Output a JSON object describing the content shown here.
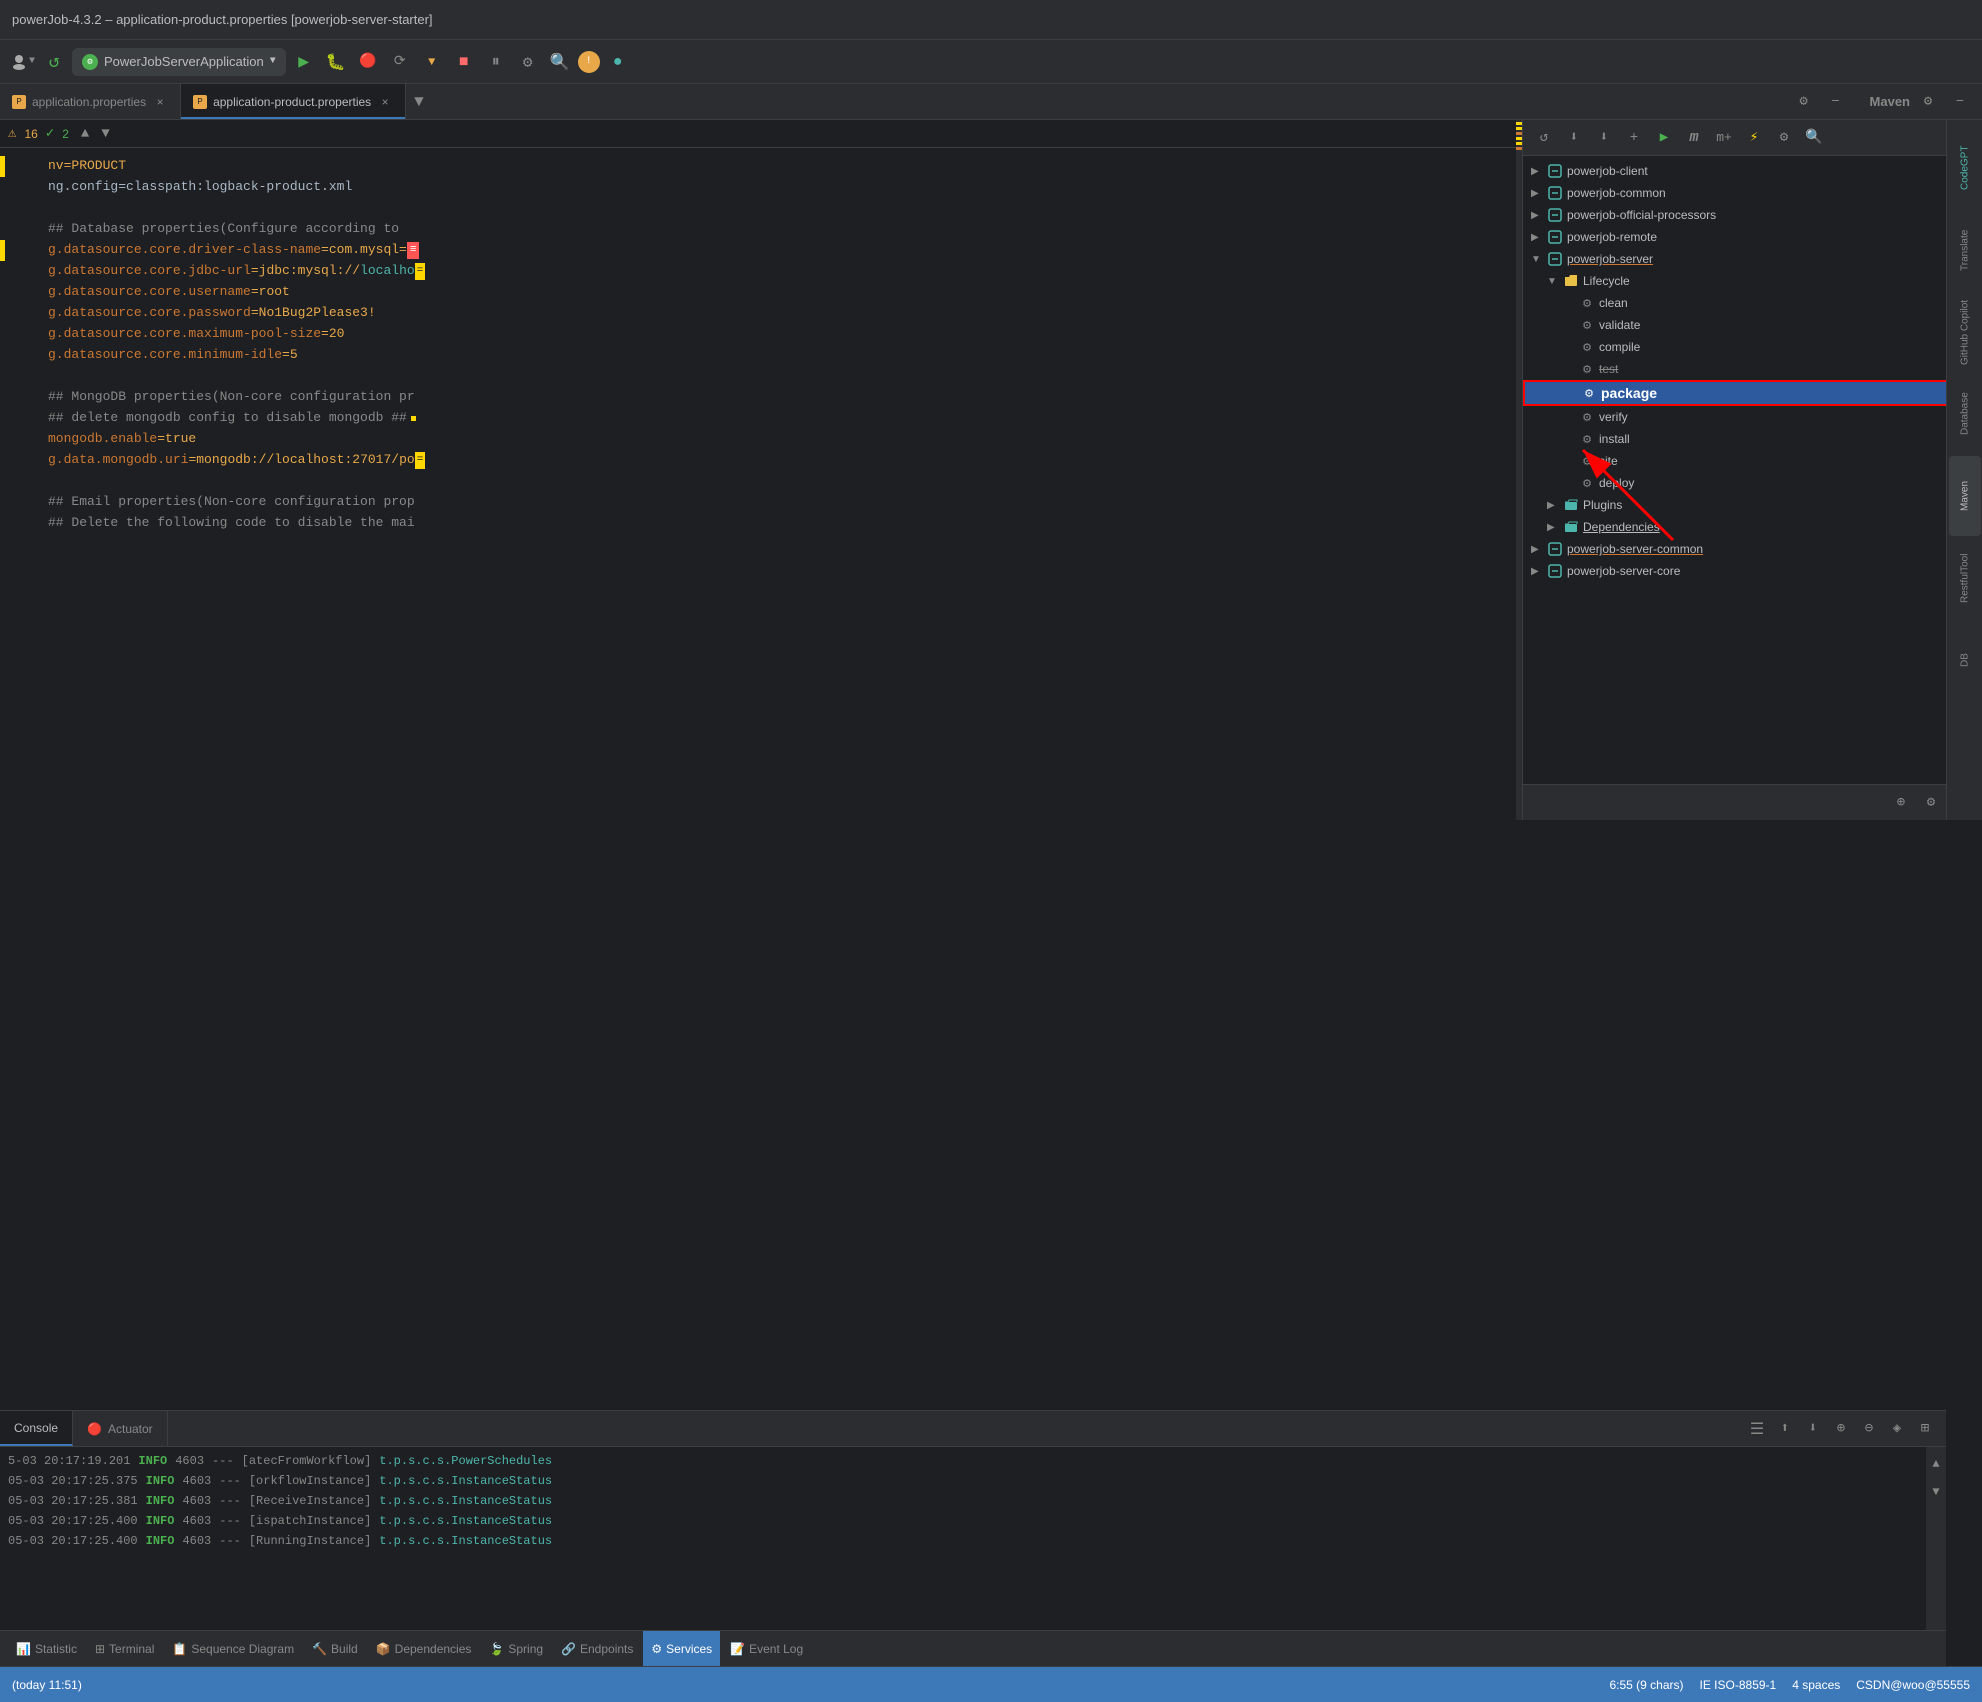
{
  "window": {
    "title": "powerJob-4.3.2 – application-product.properties [powerjob-server-starter]"
  },
  "toolbar": {
    "run_config": "PowerJobServerApplication",
    "run_label": "▶",
    "debug_label": "🐛",
    "stop_label": "■"
  },
  "tabs": {
    "items": [
      {
        "label": "application.properties",
        "active": false
      },
      {
        "label": "application-product.properties",
        "active": true
      }
    ]
  },
  "warning_bar": {
    "warning_count": "16",
    "check_count": "2"
  },
  "editor": {
    "lines": [
      {
        "num": "",
        "content_parts": [
          {
            "text": "nv=PRODUCT",
            "color": "yellow"
          }
        ]
      },
      {
        "num": "",
        "content_parts": [
          {
            "text": "ng.config=classpath:logback-product.xml",
            "color": "white"
          }
        ]
      },
      {
        "num": "",
        "content_parts": []
      },
      {
        "num": "",
        "content_parts": [
          {
            "text": "## Database properties(Configure according to",
            "color": "gray"
          }
        ]
      },
      {
        "num": "",
        "content_parts": [
          {
            "text": "g.datasource.core.driver-class-name",
            "color": "orange"
          },
          {
            "text": "=com.mysql=",
            "color": "yellow"
          }
        ]
      },
      {
        "num": "",
        "content_parts": [
          {
            "text": "g.datasource.core.jdbc-url",
            "color": "orange"
          },
          {
            "text": "=jdbc:mysql://",
            "color": "yellow"
          },
          {
            "text": "localho",
            "color": "cyan"
          }
        ]
      },
      {
        "num": "",
        "content_parts": [
          {
            "text": "g.datasource.core.username",
            "color": "orange"
          },
          {
            "text": "=root",
            "color": "yellow"
          }
        ]
      },
      {
        "num": "",
        "content_parts": [
          {
            "text": "g.datasource.core.password",
            "color": "orange"
          },
          {
            "text": "=No1Bug2Please3!",
            "color": "yellow"
          }
        ]
      },
      {
        "num": "",
        "content_parts": [
          {
            "text": "g.datasource.core.maximum-pool-size",
            "color": "orange"
          },
          {
            "text": "=20",
            "color": "yellow"
          }
        ]
      },
      {
        "num": "",
        "content_parts": [
          {
            "text": "g.datasource.core.minimum-idle",
            "color": "orange"
          },
          {
            "text": "=5",
            "color": "yellow"
          }
        ]
      },
      {
        "num": "",
        "content_parts": []
      },
      {
        "num": "",
        "content_parts": [
          {
            "text": "## MongoDB properties(Non-core configuration pr",
            "color": "gray"
          }
        ]
      },
      {
        "num": "",
        "content_parts": [
          {
            "text": "## delete mongodb config to disable mongodb ##",
            "color": "gray"
          }
        ]
      },
      {
        "num": "",
        "content_parts": [
          {
            "text": "mongodb.enable",
            "color": "orange"
          },
          {
            "text": "=true",
            "color": "yellow"
          }
        ]
      },
      {
        "num": "",
        "content_parts": [
          {
            "text": "g.data.mongodb.uri",
            "color": "orange"
          },
          {
            "text": "=mongodb://localhost:27017/po",
            "color": "yellow"
          }
        ]
      },
      {
        "num": "",
        "content_parts": []
      },
      {
        "num": "",
        "content_parts": [
          {
            "text": "## Email properties(Non-core configuration prop",
            "color": "gray"
          }
        ]
      },
      {
        "num": "",
        "content_parts": [
          {
            "text": "## Delete the following code to disable the mai",
            "color": "gray"
          }
        ]
      }
    ]
  },
  "maven": {
    "title": "Maven",
    "tree": {
      "items": [
        {
          "indent": 0,
          "label": "powerjob-client",
          "icon": "module",
          "expanded": false,
          "arrow": "▶"
        },
        {
          "indent": 0,
          "label": "powerjob-common",
          "icon": "module",
          "expanded": false,
          "arrow": "▶"
        },
        {
          "indent": 0,
          "label": "powerjob-official-processors",
          "icon": "module",
          "expanded": false,
          "arrow": "▶"
        },
        {
          "indent": 0,
          "label": "powerjob-remote",
          "icon": "module",
          "expanded": false,
          "arrow": "▶"
        },
        {
          "indent": 0,
          "label": "powerjob-server",
          "icon": "module",
          "expanded": true,
          "arrow": "▼"
        },
        {
          "indent": 1,
          "label": "Lifecycle",
          "icon": "folder",
          "expanded": true,
          "arrow": "▼"
        },
        {
          "indent": 2,
          "label": "clean",
          "icon": "gear",
          "arrow": ""
        },
        {
          "indent": 2,
          "label": "validate",
          "icon": "gear",
          "arrow": ""
        },
        {
          "indent": 2,
          "label": "compile",
          "icon": "gear",
          "arrow": ""
        },
        {
          "indent": 2,
          "label": "test",
          "icon": "gear",
          "arrow": ""
        },
        {
          "indent": 2,
          "label": "package",
          "icon": "gear",
          "arrow": "",
          "selected": true
        },
        {
          "indent": 2,
          "label": "verify",
          "icon": "gear",
          "arrow": ""
        },
        {
          "indent": 2,
          "label": "install",
          "icon": "gear",
          "arrow": ""
        },
        {
          "indent": 2,
          "label": "site",
          "icon": "gear",
          "arrow": ""
        },
        {
          "indent": 2,
          "label": "deploy",
          "icon": "gear",
          "arrow": ""
        },
        {
          "indent": 1,
          "label": "Plugins",
          "icon": "folder",
          "expanded": false,
          "arrow": "▶"
        },
        {
          "indent": 1,
          "label": "Dependencies",
          "icon": "folder",
          "expanded": false,
          "arrow": "▶"
        },
        {
          "indent": 0,
          "label": "powerjob-server-common",
          "icon": "module",
          "expanded": false,
          "arrow": "▶"
        },
        {
          "indent": 0,
          "label": "powerjob-server-core",
          "icon": "module",
          "expanded": false,
          "arrow": "▶"
        }
      ]
    }
  },
  "bottom_panel": {
    "tabs": [
      {
        "label": "Console",
        "active": true,
        "icon": ""
      },
      {
        "label": "Actuator",
        "active": false,
        "icon": "🔴"
      }
    ],
    "log_lines": [
      {
        "timestamp": "5-03 20:17:19.201",
        "level": "INFO",
        "pid": "4603",
        "sep": "---",
        "thread": "[atecFromWorkflow]",
        "class": "t.p.s.c.s.PowerSchedules"
      },
      {
        "timestamp": "05-03 20:17:25.375",
        "level": "INFO",
        "pid": "4603",
        "sep": "---",
        "thread": "[orkflowInstance]",
        "class": "t.p.s.c.s.InstanceStatus"
      },
      {
        "timestamp": "05-03 20:17:25.381",
        "level": "INFO",
        "pid": "4603",
        "sep": "---",
        "thread": "[ReceiveInstance]",
        "class": "t.p.s.c.s.InstanceStatus"
      },
      {
        "timestamp": "05-03 20:17:25.400",
        "level": "INFO",
        "pid": "4603",
        "sep": "---",
        "thread": "[ispatchInstance]",
        "class": "t.p.s.c.s.InstanceStatus"
      },
      {
        "timestamp": "05-03 20:17:25.400",
        "level": "INFO",
        "pid": "4603",
        "sep": "---",
        "thread": "[RunningInstance]",
        "class": "t.p.s.c.s.InstanceStatus"
      }
    ]
  },
  "status_bar": {
    "items": [
      {
        "label": "Statistic",
        "icon": "📊"
      },
      {
        "label": "Terminal",
        "icon": "⊞"
      },
      {
        "label": "Sequence Diagram",
        "icon": "📋"
      },
      {
        "label": "Build",
        "icon": "🔨"
      },
      {
        "label": "Dependencies",
        "icon": "📦"
      },
      {
        "label": "Spring",
        "icon": "🍃"
      },
      {
        "label": "Endpoints",
        "icon": "🔗"
      },
      {
        "label": "Services",
        "icon": "⚙",
        "active": true
      },
      {
        "label": "Event Log",
        "icon": "📝"
      }
    ],
    "right_info": {
      "position": "6:55 (9 chars)",
      "encoding": "IE  ISO-8859-1",
      "spaces": "4 spaces",
      "user": "CSDN@woo@55555",
      "row_col": "(today 11:51)"
    }
  },
  "right_sidebar": {
    "tools": [
      {
        "label": "CodeGPT",
        "icon": "🤖"
      },
      {
        "label": "Translate",
        "icon": "🌐"
      },
      {
        "label": "GitHub Copilot",
        "icon": "⬡"
      },
      {
        "label": "Database",
        "icon": "🗄"
      },
      {
        "label": "Maven",
        "icon": "m"
      },
      {
        "label": "RestfulTool",
        "icon": "🔌"
      },
      {
        "label": "DB",
        "icon": "D"
      }
    ]
  },
  "colors": {
    "accent_blue": "#3d78b8",
    "selected_bg": "#2d5a9e",
    "warning": "#e8a84a",
    "error": "#ff5555",
    "success": "#4caf50",
    "red_arrow": "#ff0000"
  }
}
